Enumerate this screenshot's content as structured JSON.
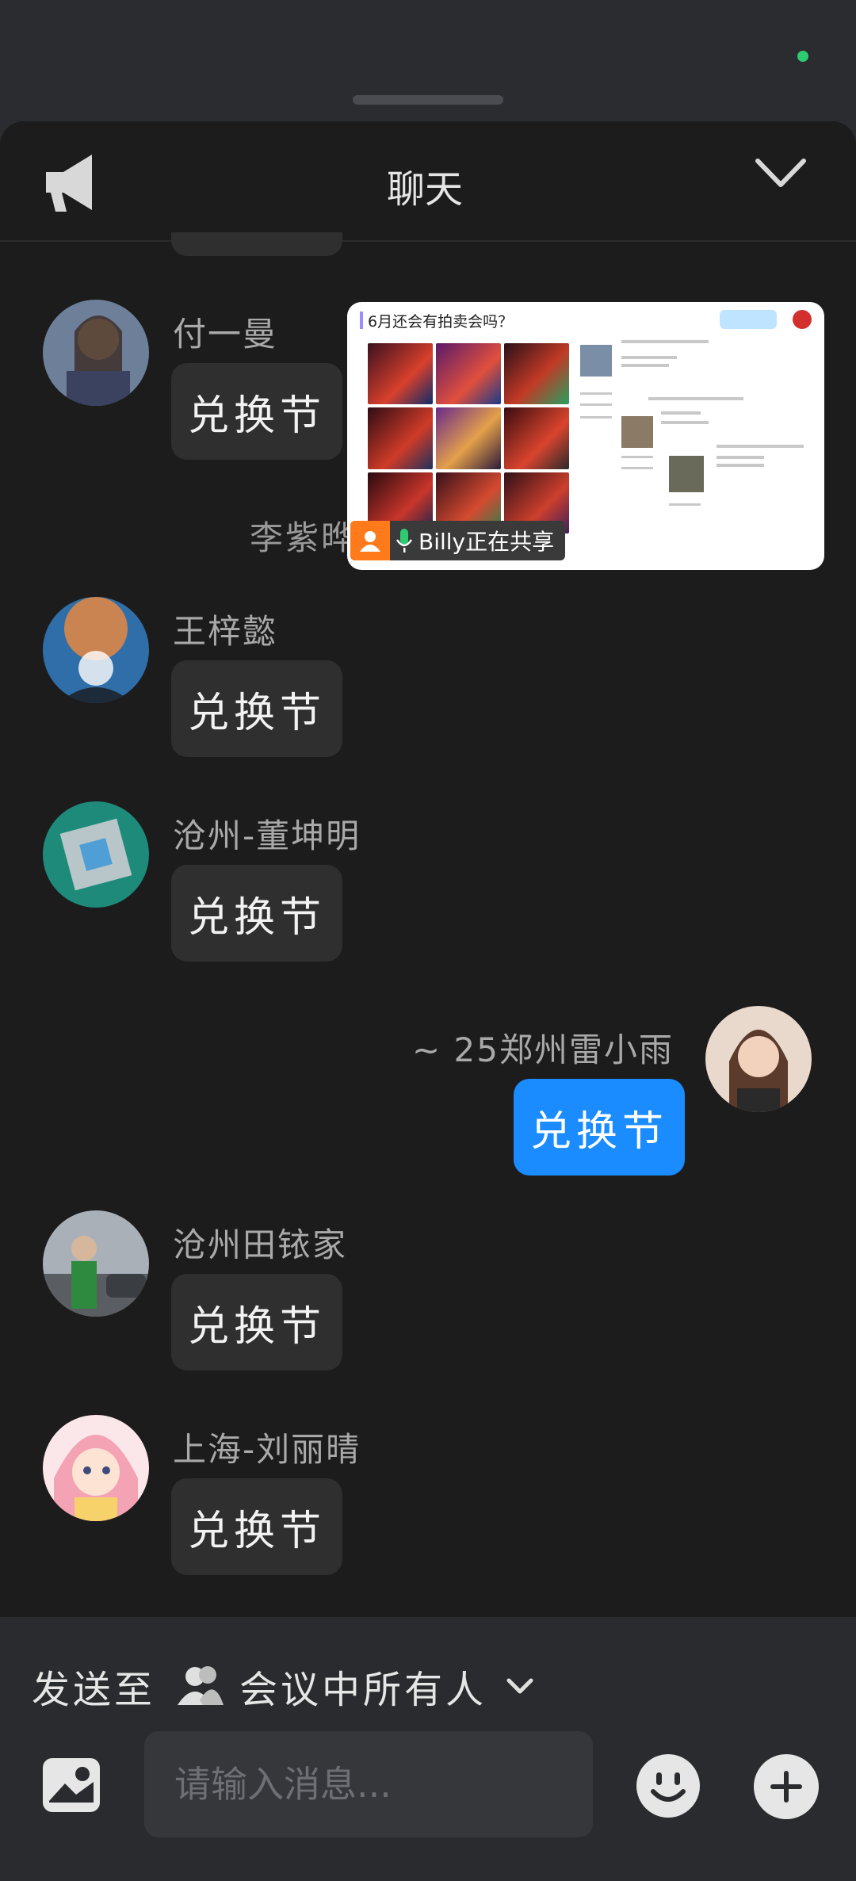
{
  "header": {
    "title": "聊天"
  },
  "screen_share": {
    "doc_title": "6月还会有拍卖会吗？",
    "presenter_status": "Billy正在共享"
  },
  "messages": [
    {
      "sender": "付一曼",
      "text": "兑换节"
    },
    {
      "sender": "王梓懿",
      "text": "兑换节"
    },
    {
      "sender": "沧州-董坤明",
      "text": "兑换节"
    },
    {
      "sender": "~   25郑州雷小雨",
      "text": "兑换节"
    },
    {
      "sender": "沧州田铱家",
      "text": "兑换节"
    },
    {
      "sender": "上海-刘丽晴",
      "text": "兑换节"
    }
  ],
  "recall_notice": "李紫晔撤回了一条消息",
  "composer": {
    "send_to_label": "发送至",
    "recipient": "会议中所有人",
    "placeholder": "请输入消息..."
  },
  "colors": {
    "own_bubble": "#1a8cff",
    "online_dot": "#2ecc71",
    "sharing_badge": "#ff7a1a"
  },
  "icons": [
    "speaker-icon",
    "chevron-down-icon",
    "presenter-icon",
    "microphone-icon",
    "group-icon",
    "image-icon",
    "emoji-icon",
    "plus-icon"
  ]
}
